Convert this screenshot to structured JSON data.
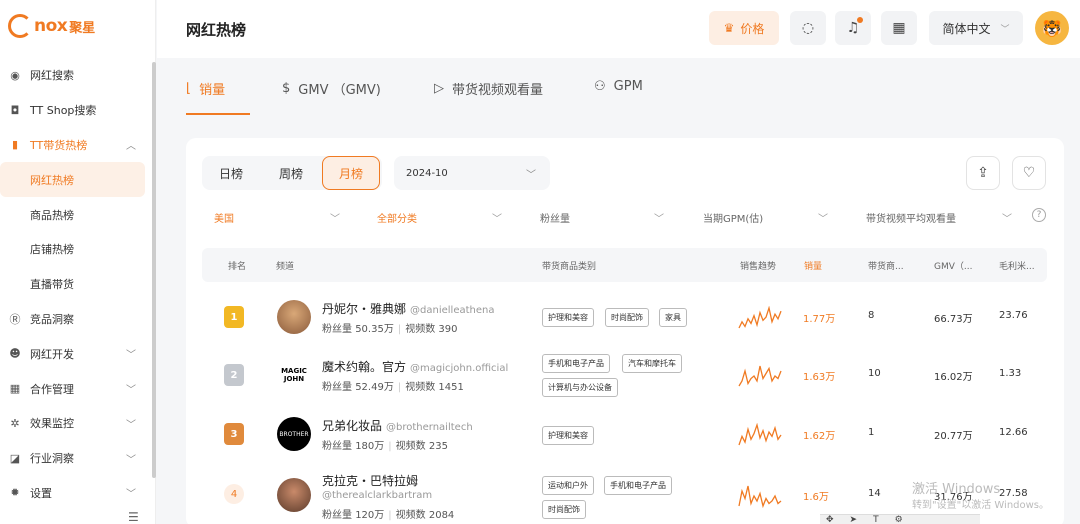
{
  "logo": {
    "text": "nox",
    "cn": "聚星"
  },
  "sidebar": {
    "items": [
      {
        "label": "网红搜索",
        "icon": "compass-icon",
        "glyph": "◉"
      },
      {
        "label": "TT Shop搜索",
        "icon": "shop-bag-icon",
        "glyph": "◘"
      },
      {
        "label": "TT带货热榜",
        "icon": "bar-chart-icon",
        "glyph": "▮"
      },
      {
        "label": "网红热榜",
        "icon": "",
        "glyph": ""
      },
      {
        "label": "商品热榜",
        "icon": "",
        "glyph": ""
      },
      {
        "label": "店铺热榜",
        "icon": "",
        "glyph": ""
      },
      {
        "label": "直播带货",
        "icon": "",
        "glyph": ""
      },
      {
        "label": "竞品洞察",
        "icon": "r-badge-icon",
        "glyph": "Ⓡ"
      },
      {
        "label": "网红开发",
        "icon": "users-icon",
        "glyph": "☻"
      },
      {
        "label": "合作管理",
        "icon": "calendar-icon",
        "glyph": "▦"
      },
      {
        "label": "效果监控",
        "icon": "gear-cog-icon",
        "glyph": "✲"
      },
      {
        "label": "行业洞察",
        "icon": "trend-chart-icon",
        "glyph": "◪"
      },
      {
        "label": "设置",
        "icon": "settings-icon",
        "glyph": "✹"
      }
    ]
  },
  "header": {
    "title": "网红热榜",
    "price_label": "价格",
    "language": "简体中文"
  },
  "tabs": [
    {
      "label": "销量",
      "glyph": "⌊"
    },
    {
      "label": "GMV （GMV)",
      "glyph": "$"
    },
    {
      "label": "带货视频观看量",
      "glyph": "▷"
    },
    {
      "label": "GPM",
      "glyph": "⚇"
    }
  ],
  "period": {
    "daily": "日榜",
    "weekly": "周榜",
    "monthly": "月榜",
    "date": "2024-10"
  },
  "filters": {
    "country": "美国",
    "category": "全部分类",
    "followers": "粉丝量",
    "gpm": "当期GPM(估)",
    "avg_views": "带货视频平均观看量"
  },
  "table": {
    "headers": {
      "rank": "排名",
      "channel": "频道",
      "category": "带货商品类别",
      "trend": "销售趋势",
      "sales": "销量",
      "products": "带货商...",
      "gmv": "GMV（...",
      "margin": "毛利米..."
    },
    "follower_prefix": "粉丝量",
    "video_prefix": "视频数",
    "rows": [
      {
        "rank": "1",
        "name": "丹妮尔・雅典娜",
        "handle": "@danielleathena",
        "followers": "50.35万",
        "videos": "390",
        "tags": [
          "护理和美容",
          "时尚配饰",
          "家具"
        ],
        "sales": "1.77万",
        "products": "8",
        "gmv": "66.73万",
        "margin": "23.76",
        "trend": [
          5,
          9,
          6,
          11,
          8,
          13,
          7,
          15,
          10,
          12,
          18,
          9,
          14,
          11,
          16
        ]
      },
      {
        "rank": "2",
        "name": "魔术约翰。官方",
        "handle": "@magicjohn.official",
        "followers": "52.49万",
        "videos": "1451",
        "tags": [
          "手机和电子产品",
          "汽车和摩托车",
          "计算机与办公设备"
        ],
        "sales": "1.63万",
        "products": "10",
        "gmv": "16.02万",
        "margin": "1.33",
        "trend": [
          6,
          8,
          12,
          7,
          9,
          10,
          8,
          14,
          9,
          11,
          13,
          8,
          10,
          9,
          12
        ]
      },
      {
        "rank": "3",
        "name": "兄弟化妆品",
        "handle": "@brothernailtech",
        "followers": "180万",
        "videos": "235",
        "tags": [
          "护理和美容"
        ],
        "sales": "1.62万",
        "products": "1",
        "gmv": "20.77万",
        "margin": "12.66",
        "trend": [
          4,
          10,
          6,
          15,
          8,
          12,
          18,
          9,
          14,
          7,
          13,
          10,
          16,
          8,
          11
        ]
      },
      {
        "rank": "4",
        "name": "克拉克・巴特拉姆",
        "handle": "@therealclarkbartram",
        "followers": "120万",
        "videos": "2084",
        "tags": [
          "运动和户外",
          "手机和电子产品",
          "时尚配饰"
        ],
        "sales": "1.6万",
        "products": "14",
        "gmv": "31.76万",
        "margin": "27.58",
        "trend": [
          8,
          14,
          11,
          16,
          9,
          12,
          10,
          13,
          8,
          11,
          9,
          10,
          12,
          9,
          10
        ]
      }
    ]
  },
  "avatar_labels": {
    "magic": "MAGIC JOHN",
    "brother": "BROTHER"
  },
  "watermark": {
    "line1": "激活 Windows",
    "line2": "转到\"设置\"以激活 Windows。"
  },
  "colors": {
    "accent": "#f07a22",
    "gold": "#f2b824",
    "silver": "#c4c8ce",
    "bronze": "#e08a3c"
  }
}
